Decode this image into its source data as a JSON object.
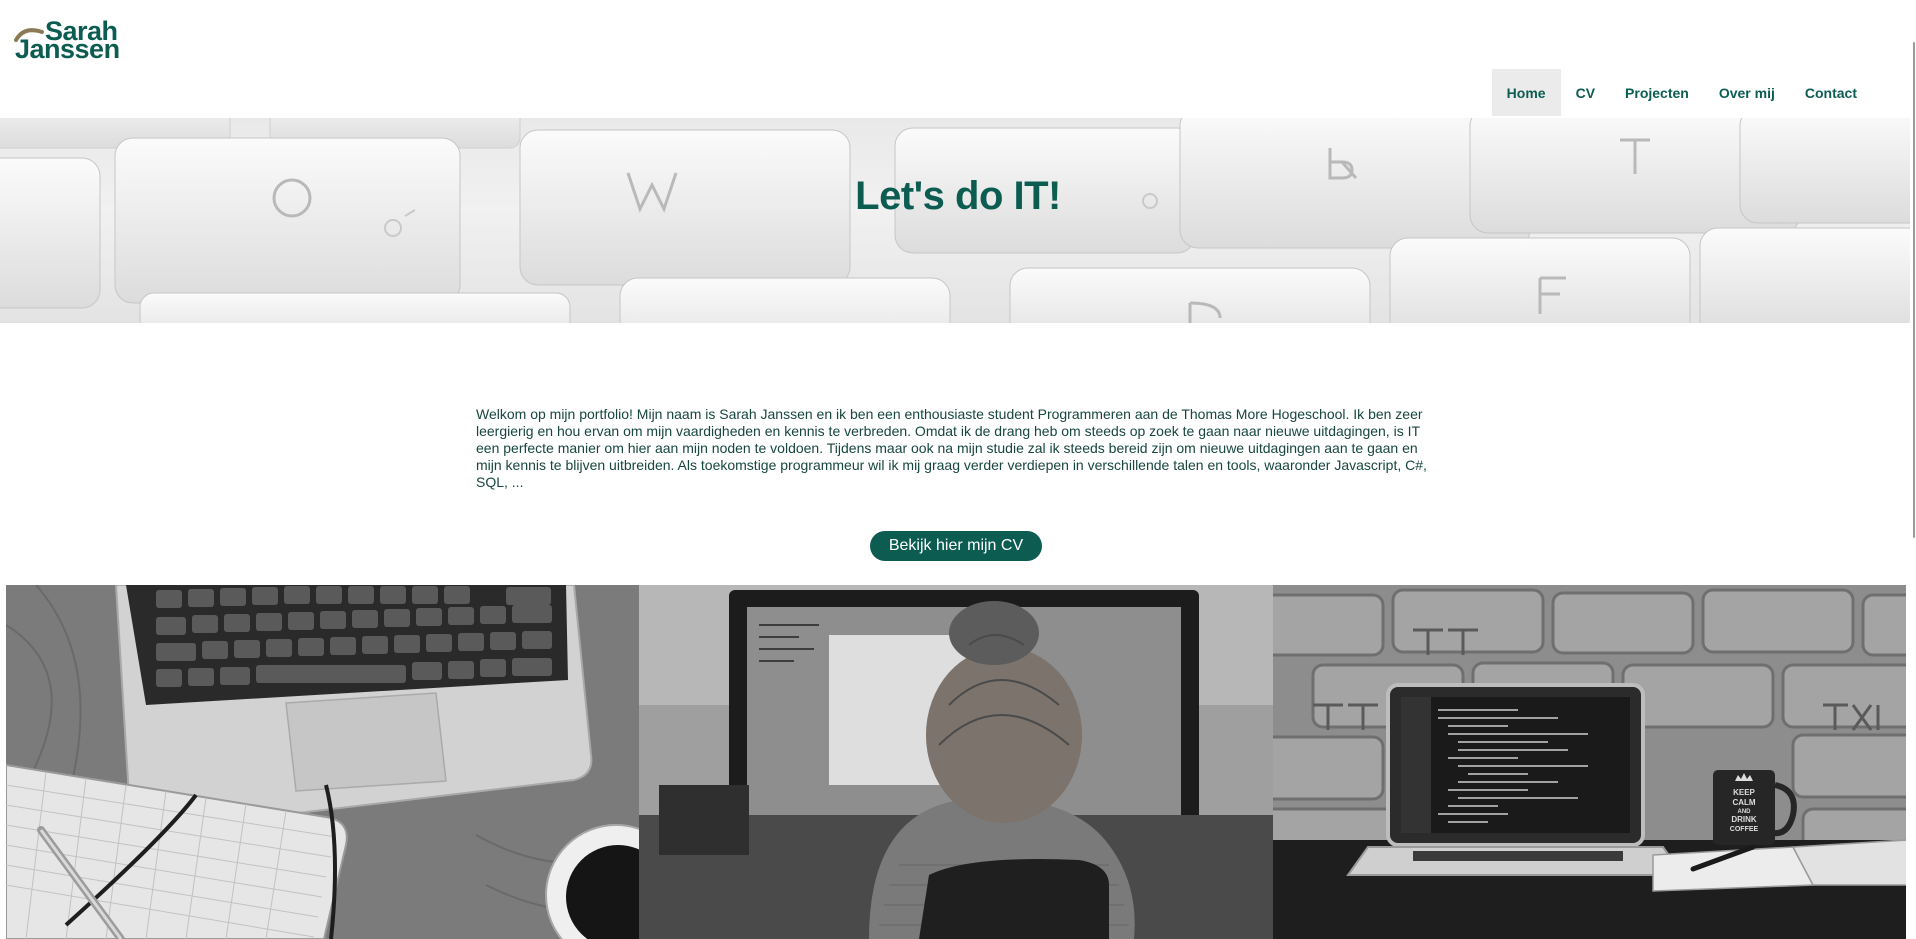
{
  "site": {
    "logo_line1": "Sarah",
    "logo_line2": "Janssen"
  },
  "nav": {
    "items": [
      "Home",
      "CV",
      "Projecten",
      "Over mij",
      "Contact"
    ],
    "active": "Home"
  },
  "hero": {
    "title": "Let's do IT!"
  },
  "intro": {
    "text": "Welkom op mijn portfolio! Mijn naam is Sarah Janssen en ik ben een enthousiaste student Programmeren aan de Thomas More Hogeschool. Ik ben zeer leergierig en hou ervan om mijn vaardigheden en kennis te verbreden. Omdat ik de drang heb om steeds op zoek te gaan naar nieuwe uitdagingen, is IT een perfecte manier om hier aan mijn noden te voldoen. Tijdens maar ook na mijn studie zal ik steeds bereid zijn om nieuwe uitdagingen aan te gaan en mijn kennis te blijven uitbreiden. Als toekomstige programmeur wil ik mij graag verder verdiepen in verschillende talen en tools, waaronder Javascript, C#, SQL, ..."
  },
  "cta": {
    "label": "Bekijk hier mijn CV"
  },
  "photos": {
    "mug_text": [
      "KEEP",
      "CALM",
      "AND",
      "DRINK",
      "COFFEE"
    ]
  },
  "colors": {
    "brand": "#0d5c52",
    "nav_active_bg": "#ebebeb"
  }
}
